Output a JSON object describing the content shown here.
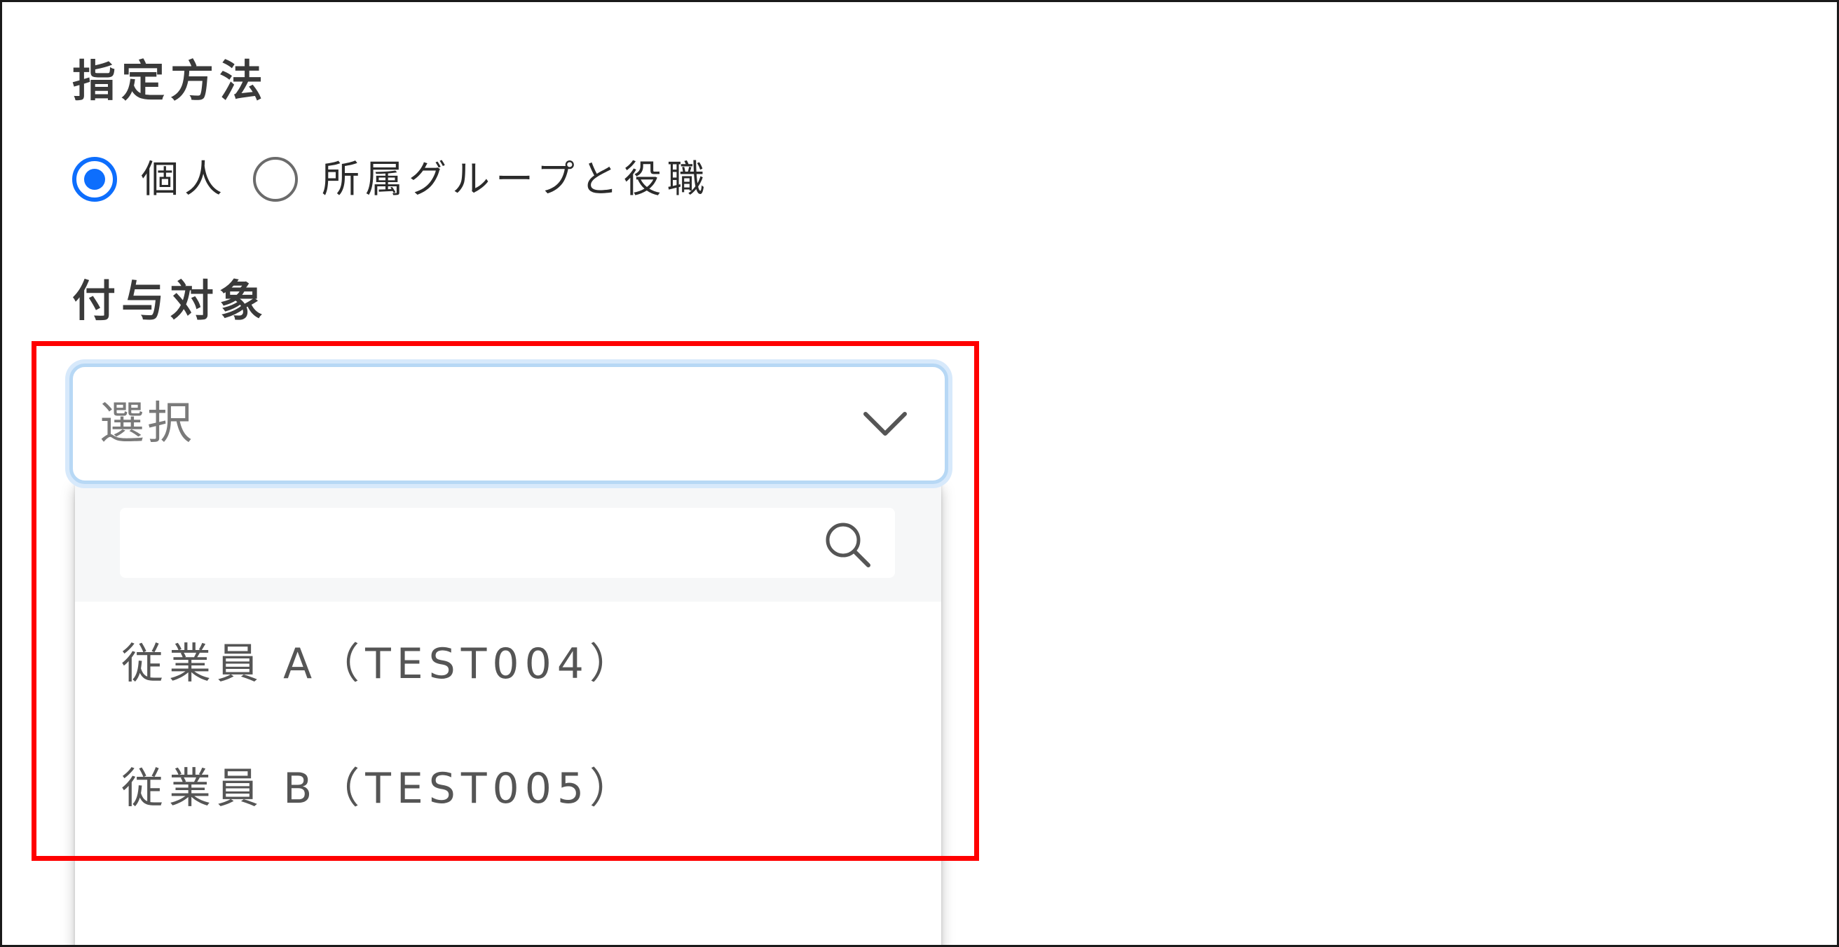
{
  "form": {
    "method_label": "指定方法",
    "method_options": [
      {
        "label": "個人",
        "selected": true
      },
      {
        "label": "所属グループと役職",
        "selected": false
      }
    ],
    "target_label": "付与対象"
  },
  "select": {
    "placeholder": "選択",
    "chevron_icon": "chevron-down-icon"
  },
  "dropdown": {
    "search_value": "",
    "search_icon": "search-icon",
    "options": [
      {
        "label": "従業員 A（TEST004）"
      },
      {
        "label": "従業員 B（TEST005）"
      }
    ]
  },
  "colors": {
    "accent": "#0d6efd",
    "highlight": "#ff0000",
    "select_focus": "#b7d8f5"
  }
}
